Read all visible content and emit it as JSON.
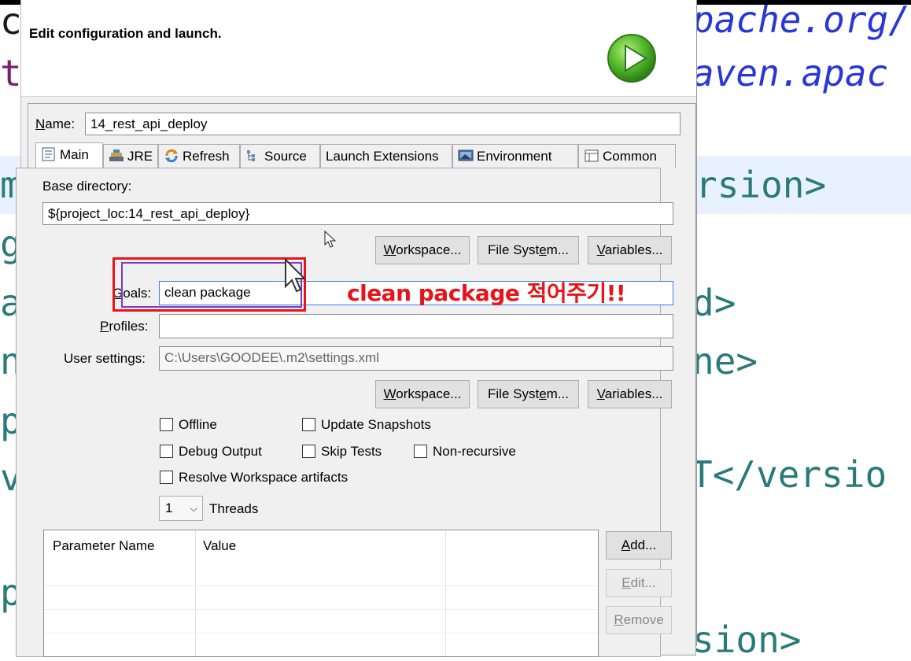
{
  "background_code": {
    "lines": [
      {
        "text": "c",
        "color": "#1a1a1a"
      },
      {
        "text": "ts",
        "color": "#7b1f6e"
      },
      {
        "text": "m",
        "color": "#2a7a7a"
      },
      {
        "text": "g",
        "color": "#2a7a7a"
      },
      {
        "text": "a",
        "color": "#2a7a7a"
      },
      {
        "text": "n",
        "color": "#2a7a7a"
      },
      {
        "text": "p",
        "color": "#2a7a7a"
      },
      {
        "text": "v",
        "color": "#2a7a7a"
      },
      {
        "text": "p",
        "color": "#2a7a7a"
      }
    ],
    "right_lines": [
      {
        "text": "pache.org/",
        "color": "#2a37d8"
      },
      {
        "text": "aven.apac",
        "color": "#2a37d8"
      },
      {
        "text": "rsion>",
        "color": "#2a7a7a"
      },
      {
        "text": "d>",
        "color": "#2a7a7a"
      },
      {
        "text": "ne>",
        "color": "#2a7a7a"
      },
      {
        "text": "T</versio",
        "color": "#2a7a7a"
      },
      {
        "text": "sion>",
        "color": "#2a7a7a"
      }
    ]
  },
  "dialog": {
    "title": "Edit configuration and launch.",
    "name_label": "Name:",
    "name_value": "14_rest_api_deploy",
    "tabs": [
      {
        "label": "Main",
        "icon": "main-tab-icon"
      },
      {
        "label": "JRE",
        "icon": "jre-tab-icon"
      },
      {
        "label": "Refresh",
        "icon": "refresh-tab-icon"
      },
      {
        "label": "Source",
        "icon": "source-tab-icon"
      },
      {
        "label": "Launch Extensions",
        "icon": ""
      },
      {
        "label": "Environment",
        "icon": "environment-tab-icon"
      },
      {
        "label": "Common",
        "icon": "common-tab-icon"
      }
    ],
    "base_directory_label": "Base directory:",
    "base_directory_value": "${project_loc:14_rest_api_deploy}",
    "buttons": {
      "workspace": "Workspace...",
      "file_system": "File System...",
      "variables": "Variables...",
      "add": "Add...",
      "edit": "Edit...",
      "remove": "Remove"
    },
    "goals_label": "Goals:",
    "goals_value": "clean package",
    "profiles_label": "Profiles:",
    "profiles_value": "",
    "user_settings_label": "User settings:",
    "user_settings_value": "C:\\Users\\GOODEE\\.m2\\settings.xml",
    "checkboxes": {
      "offline": "Offline",
      "update_snapshots": "Update Snapshots",
      "debug_output": "Debug Output",
      "skip_tests": "Skip Tests",
      "non_recursive": "Non-recursive",
      "resolve_workspace": "Resolve Workspace artifacts"
    },
    "threads_value": "1",
    "threads_label": "Threads",
    "table_headers": [
      "Parameter Name",
      "Value"
    ]
  },
  "annotation": {
    "text": "clean package 적어주기!!",
    "color": "#e8141b"
  }
}
